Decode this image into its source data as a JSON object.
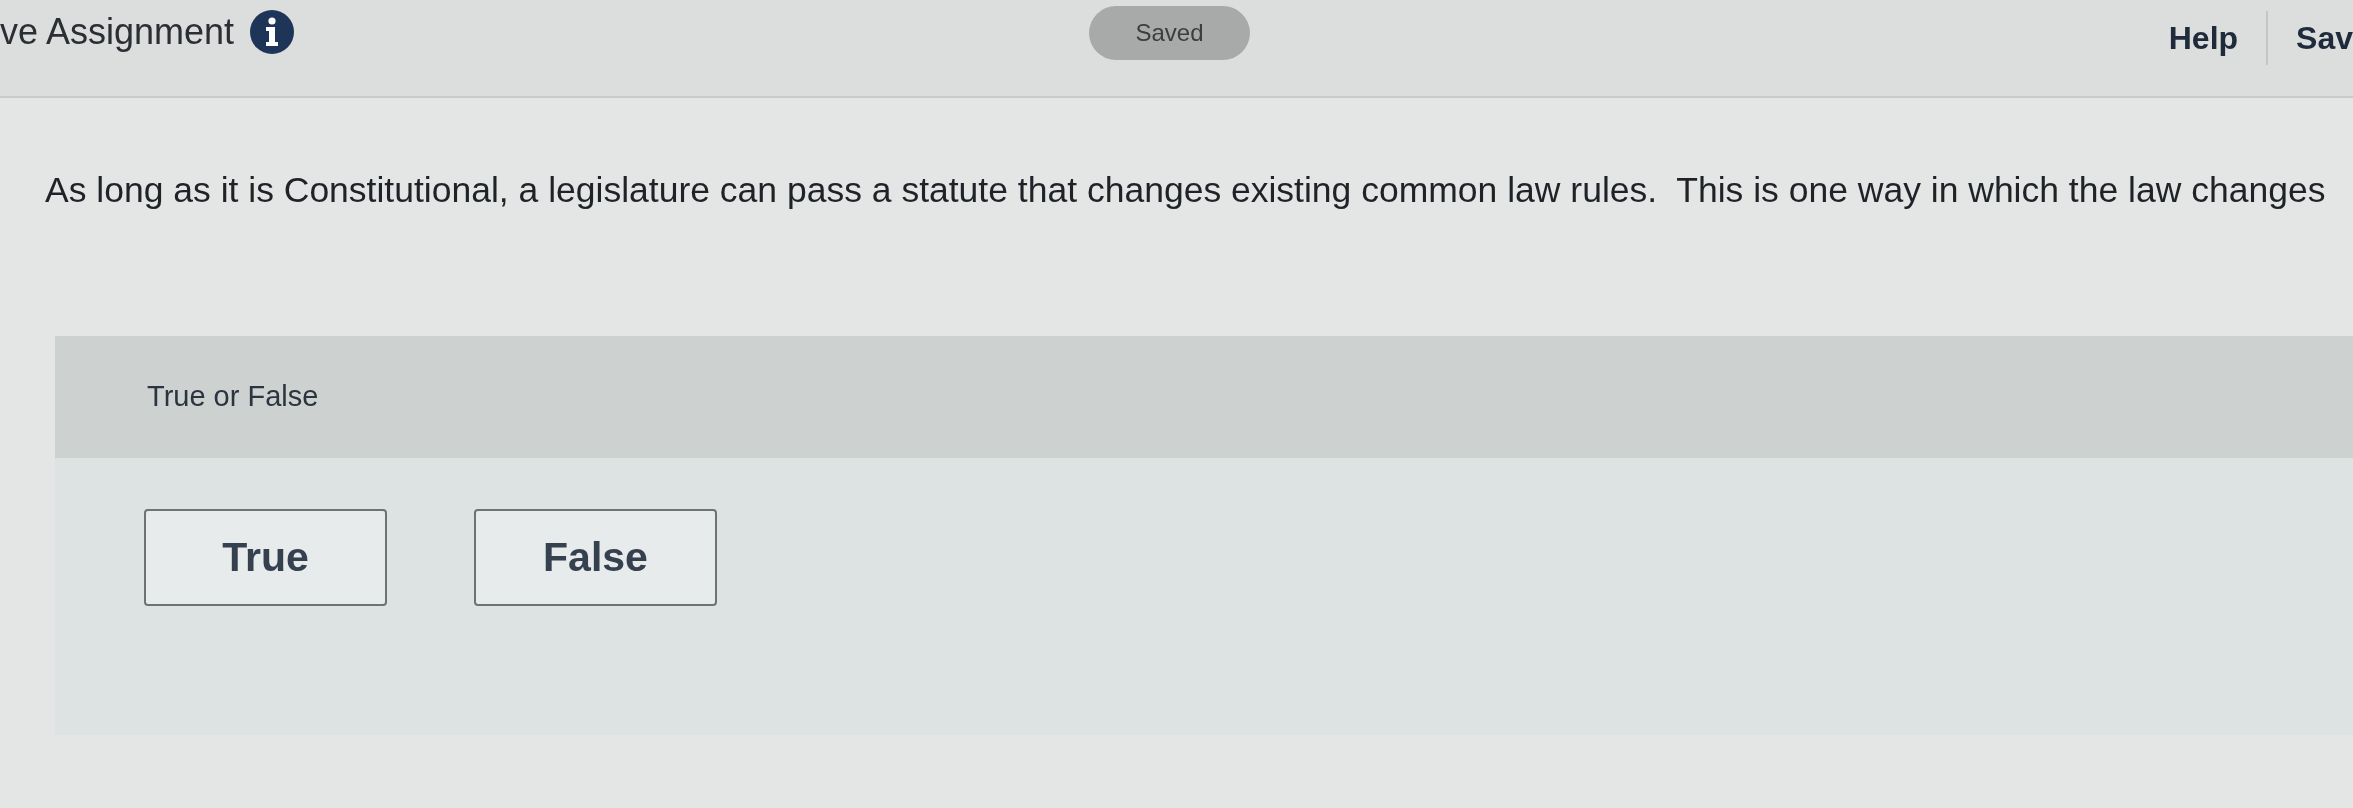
{
  "header": {
    "title": "ve Assignment",
    "status": "Saved",
    "links": [
      "Help",
      "Sav"
    ]
  },
  "question": {
    "text": "As long as it is Constitutional, a legislature can pass a statute that changes existing common law rules.  This is one way in which the law changes",
    "prompt": "True or False",
    "options": [
      {
        "label": "True",
        "selected": false
      },
      {
        "label": "False",
        "selected": false
      }
    ]
  }
}
